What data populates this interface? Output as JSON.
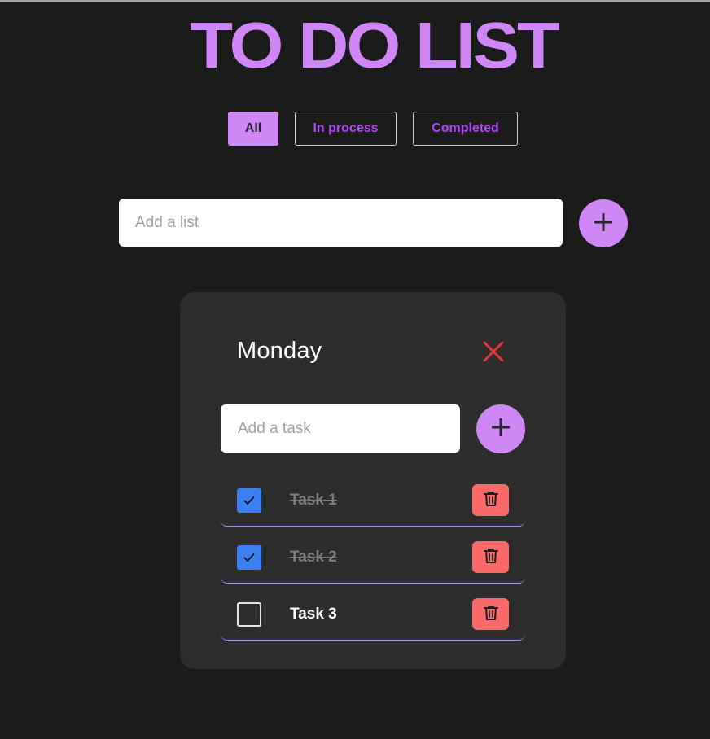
{
  "app": {
    "title": "TO DO LIST"
  },
  "filters": [
    {
      "label": "All",
      "active": true
    },
    {
      "label": "In process",
      "active": false
    },
    {
      "label": "Completed",
      "active": false
    }
  ],
  "add_list": {
    "placeholder": "Add a list",
    "value": "",
    "button_icon": "plus-icon"
  },
  "list": {
    "title": "Monday",
    "close_icon": "close-icon",
    "add_task": {
      "placeholder": "Add a task",
      "value": "",
      "button_icon": "plus-icon"
    },
    "tasks": [
      {
        "label": "Task 1",
        "completed": true
      },
      {
        "label": "Task 2",
        "completed": true
      },
      {
        "label": "Task 3",
        "completed": false
      }
    ]
  },
  "colors": {
    "background": "#1b1b1b",
    "accent": "#cf87f6",
    "filter_text": "#b046f5",
    "card": "#2d2d2d",
    "checkbox_checked": "#3b7ff2",
    "delete": "#fa6a6a",
    "close": "#e3343f"
  }
}
